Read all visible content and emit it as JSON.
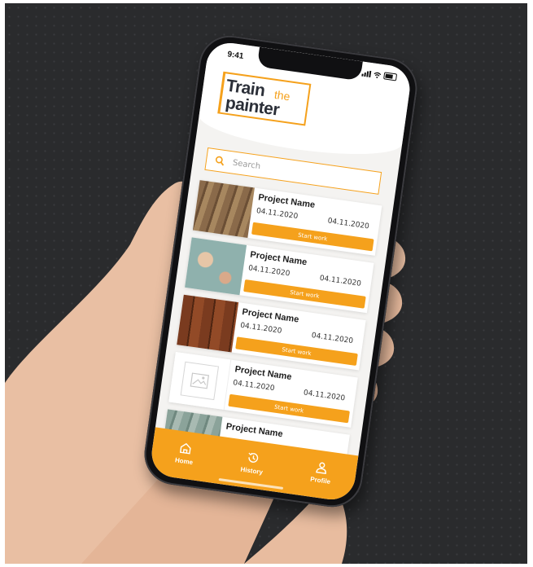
{
  "status_bar": {
    "time": "9:41"
  },
  "logo": {
    "train": "Train",
    "the": "the",
    "painter": "painter"
  },
  "search": {
    "placeholder": "Search",
    "icon": "search-icon"
  },
  "projects": [
    {
      "name": "Project Name",
      "date_start": "04.11.2020",
      "date_end": "04.11.2020",
      "button": "Start work",
      "thumbnail": "wood-planks"
    },
    {
      "name": "Project Name",
      "date_start": "04.11.2020",
      "date_end": "04.11.2020",
      "button": "Start work",
      "thumbnail": "painted-wall"
    },
    {
      "name": "Project Name",
      "date_start": "04.11.2020",
      "date_end": "04.11.2020",
      "button": "Start work",
      "thumbnail": "wood-panels"
    },
    {
      "name": "Project Name",
      "date_start": "04.11.2020",
      "date_end": "04.11.2020",
      "button": "Start work",
      "thumbnail": "image-placeholder"
    },
    {
      "name": "Project Name",
      "date_start": "",
      "date_end": "",
      "button": "",
      "thumbnail": "wood-planks"
    }
  ],
  "tabbar": {
    "items": [
      {
        "label": "Home",
        "icon": "home-icon"
      },
      {
        "label": "History",
        "icon": "history-icon"
      },
      {
        "label": "Profile",
        "icon": "profile-icon"
      }
    ]
  },
  "colors": {
    "accent": "#f5a11c",
    "logo_text": "#2b2f38",
    "backdrop": "#2a2b2d"
  }
}
